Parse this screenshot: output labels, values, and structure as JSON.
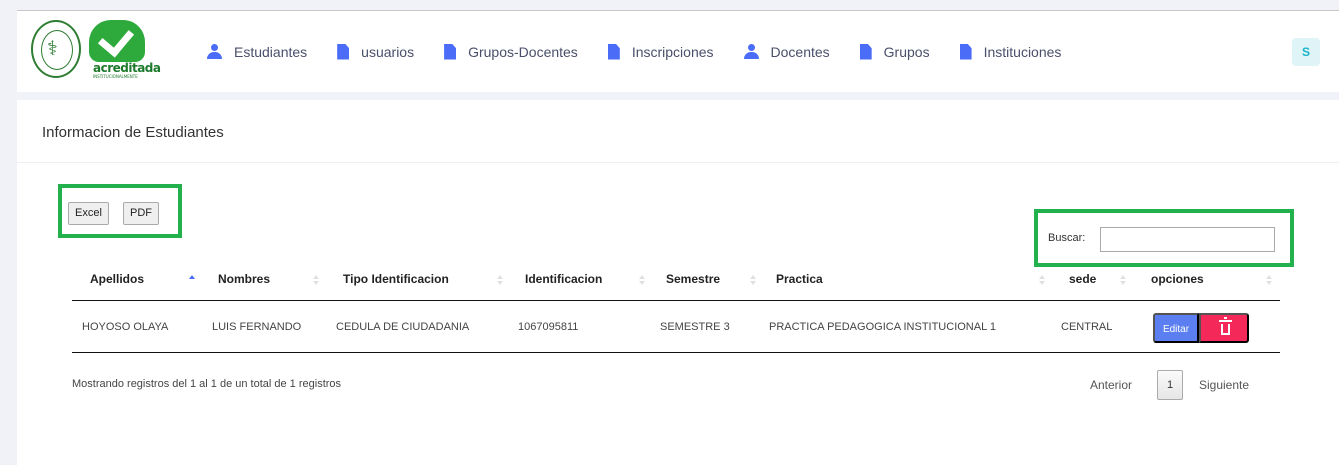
{
  "logos": {
    "seal_letter": "⚕",
    "accredited_word": "acreditada",
    "accredited_sub": "INSTITUCIONALMENTE"
  },
  "nav": {
    "items": [
      {
        "label": "Estudiantes",
        "icon": "user-icon"
      },
      {
        "label": "usuarios",
        "icon": "file-icon"
      },
      {
        "label": "Grupos-Docentes",
        "icon": "file-icon"
      },
      {
        "label": "Inscripciones",
        "icon": "file-icon"
      },
      {
        "label": "Docentes",
        "icon": "user-icon"
      },
      {
        "label": "Grupos",
        "icon": "file-icon"
      },
      {
        "label": "Instituciones",
        "icon": "file-icon"
      }
    ],
    "avatar_letter": "S"
  },
  "card": {
    "title": "Informacion de Estudiantes"
  },
  "export": {
    "excel_label": "Excel",
    "pdf_label": "PDF"
  },
  "search": {
    "label": "Buscar:",
    "value": ""
  },
  "table": {
    "headers": [
      "Apellidos",
      "Nombres",
      "Tipo Identificacion",
      "Identificacion",
      "Semestre",
      "Practica",
      "sede",
      "opciones"
    ],
    "sorted_column": "Apellidos",
    "rows": [
      {
        "apellidos": "HOYOSO OLAYA",
        "nombres": "LUIS FERNANDO",
        "tipo": "CEDULA DE CIUDADANIA",
        "identificacion": "1067095811",
        "semestre": "SEMESTRE 3",
        "practica": "PRACTICA PEDAGOGICA INSTITUCIONAL 1",
        "sede": "CENTRAL",
        "edit_label": "Editar"
      }
    ]
  },
  "footer": {
    "info": "Mostrando registros del 1 al 1 de un total de 1 registros",
    "prev": "Anterior",
    "page": "1",
    "next": "Siguiente"
  },
  "colors": {
    "accent": "#4a6cf7",
    "edit_button": "#5b7ff0",
    "delete_button": "#f5285a",
    "highlight": "#22b14c",
    "avatar_bg": "#dff4f6"
  }
}
